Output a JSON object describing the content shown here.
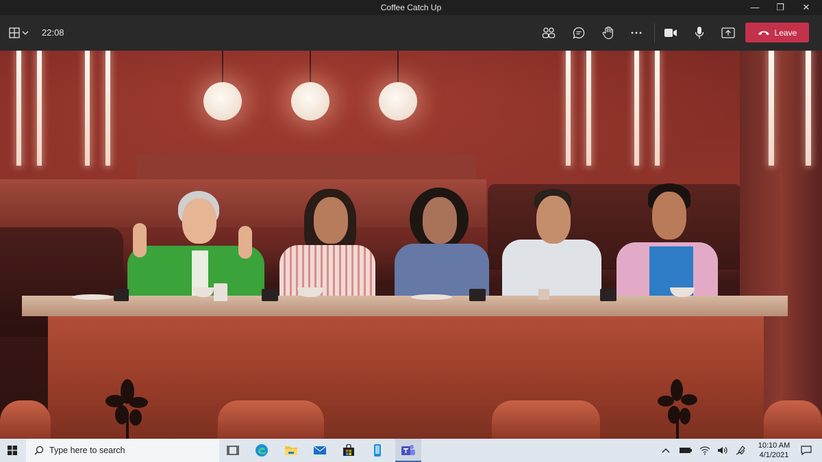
{
  "window": {
    "title": "Coffee Catch Up",
    "minimize": "—",
    "maximize": "❐",
    "close": "✕"
  },
  "toolbar": {
    "timer": "22:08",
    "leave_label": "Leave",
    "colors": {
      "leave": "#c4314b",
      "bar": "#292929"
    },
    "icons": [
      "layout-grid-icon",
      "chevron-down-icon",
      "people-icon",
      "chat-icon",
      "raise-hand-icon",
      "more-icon",
      "camera-icon",
      "microphone-icon",
      "share-screen-icon",
      "phone-hangup-icon"
    ]
  },
  "scene": {
    "mode": "together-mode",
    "participant_count": 5
  },
  "taskbar": {
    "search_placeholder": "Type here to search",
    "time": "10:10 AM",
    "date": "4/1/2021",
    "icons": [
      "windows-start-icon",
      "search-icon",
      "task-view-icon",
      "edge-icon",
      "file-explorer-icon",
      "mail-icon",
      "store-icon",
      "phone-app-icon",
      "teams-icon",
      "chevron-up-icon",
      "battery-icon",
      "network-icon",
      "volume-icon",
      "pen-icon",
      "notification-icon"
    ]
  }
}
